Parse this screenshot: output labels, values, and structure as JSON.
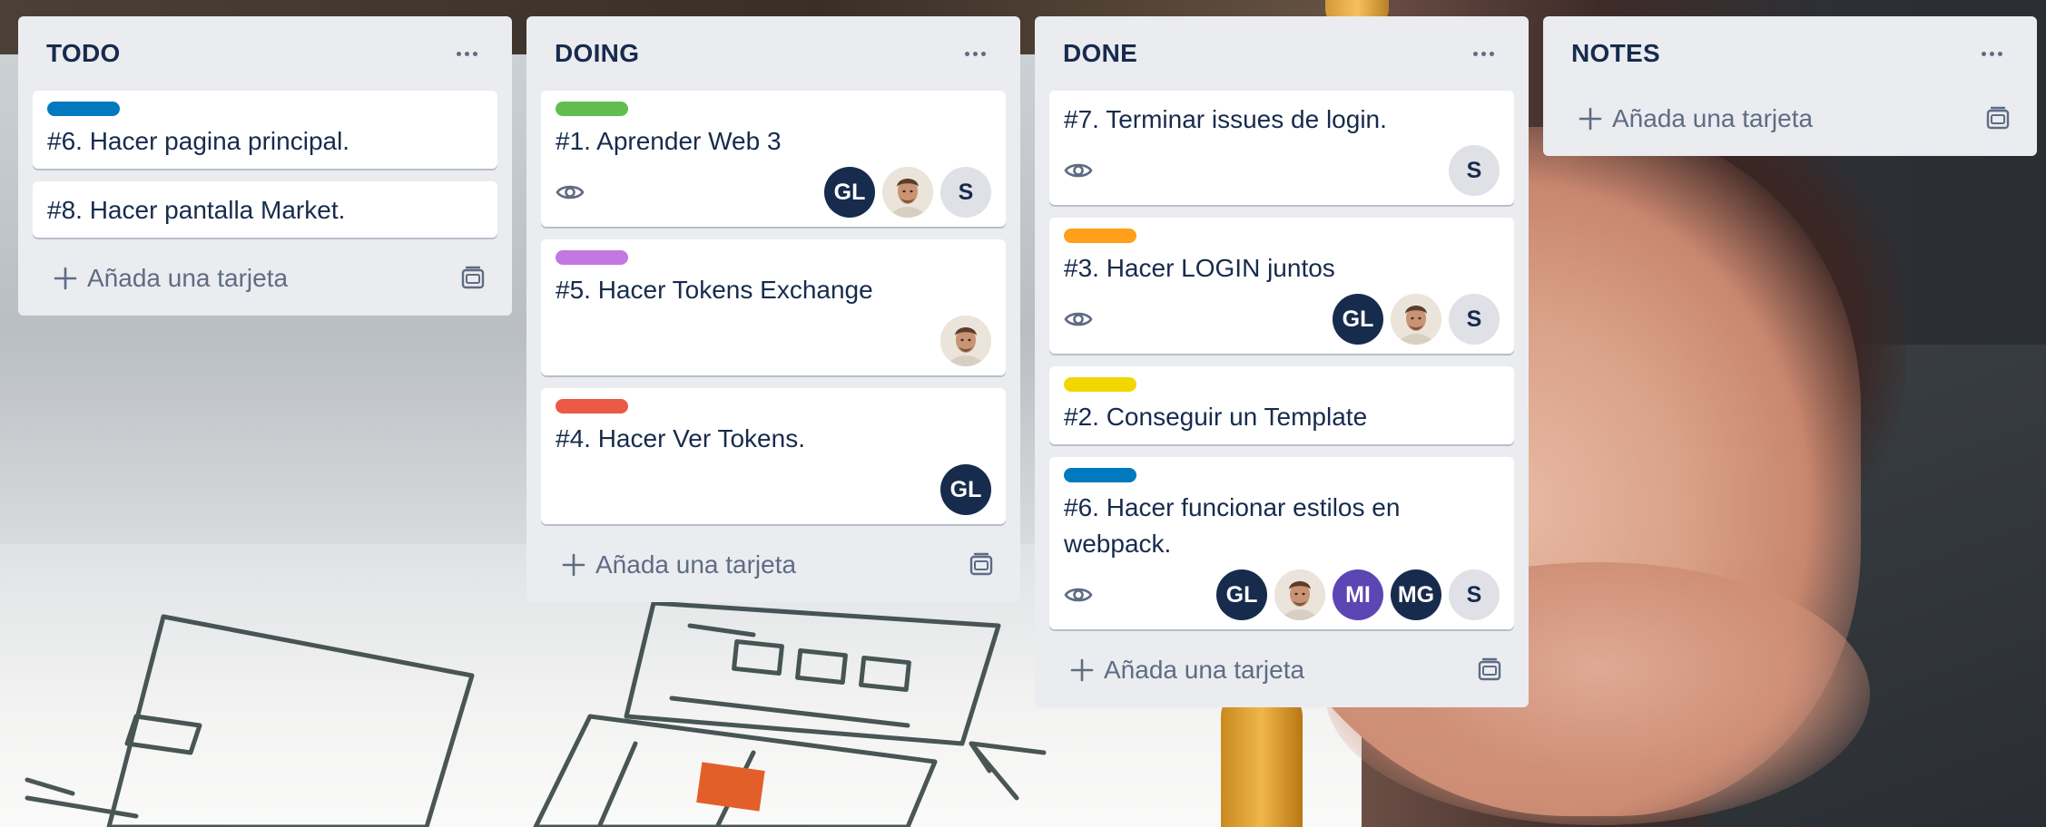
{
  "board": {
    "add_card_label": "Añada una tarjeta",
    "lists": [
      {
        "title": "TODO",
        "cards": [
          {
            "title": "#6. Hacer pagina principal.",
            "label_color": "#0079bf"
          },
          {
            "title": "#8. Hacer pantalla Market."
          }
        ]
      },
      {
        "title": "DOING",
        "cards": [
          {
            "title": "#1. Aprender Web 3",
            "label_color": "#61bd4f",
            "watching": true,
            "members": [
              "GL",
              "photo",
              "S"
            ]
          },
          {
            "title": "#5. Hacer Tokens Exchange",
            "label_color": "#c377e0",
            "members": [
              "photo"
            ]
          },
          {
            "title": "#4. Hacer Ver Tokens.",
            "label_color": "#eb5a46",
            "members": [
              "GL"
            ]
          }
        ]
      },
      {
        "title": "DONE",
        "cards": [
          {
            "title": "#7. Terminar issues de login.",
            "watching": true,
            "members": [
              "S"
            ]
          },
          {
            "title": "#3. Hacer LOGIN juntos",
            "label_color": "#ff9f1a",
            "watching": true,
            "members": [
              "GL",
              "photo",
              "S"
            ]
          },
          {
            "title": "#2. Conseguir un Template",
            "label_color": "#f2d600"
          },
          {
            "title": "#6. Hacer funcionar estilos en webpack.",
            "label_color": "#0079bf",
            "watching": true,
            "members": [
              "GL",
              "photo",
              "MI",
              "MG",
              "S"
            ]
          }
        ]
      },
      {
        "title": "NOTES",
        "cards": []
      }
    ]
  },
  "icons": {
    "list_menu": "ellipsis-icon",
    "watch": "eye-icon",
    "add": "plus-icon",
    "template": "card-template-icon"
  }
}
